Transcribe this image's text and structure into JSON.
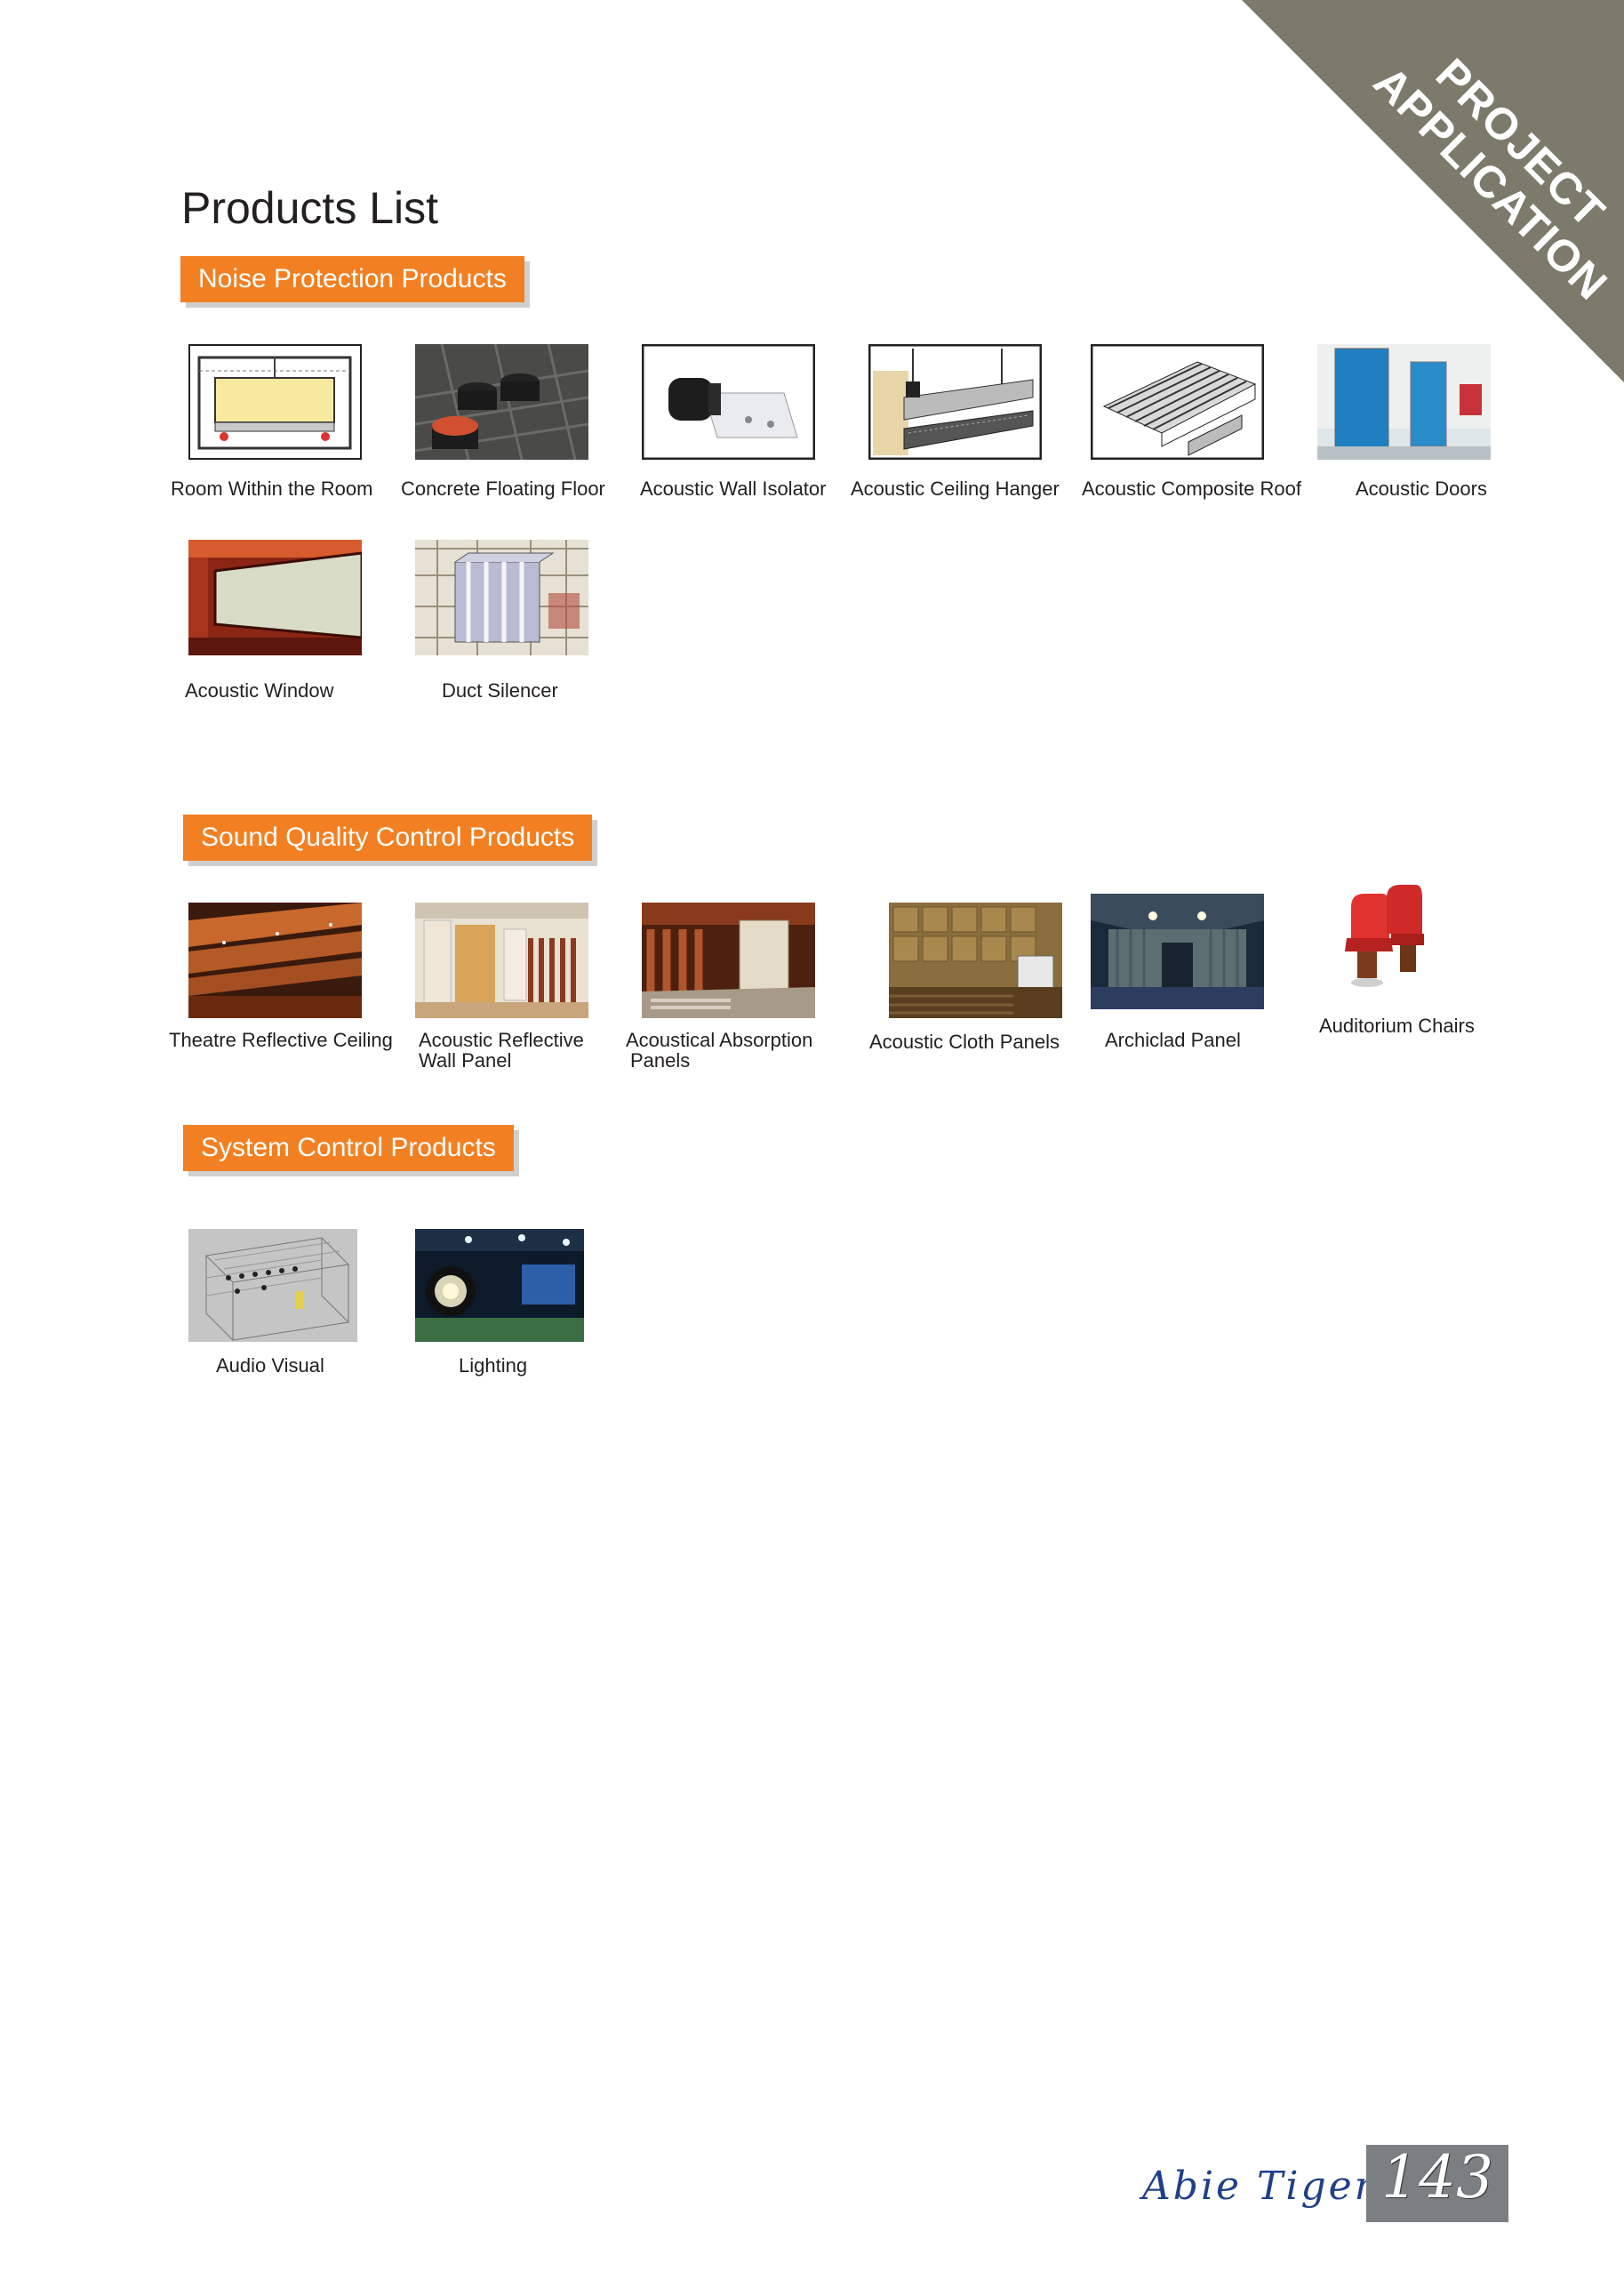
{
  "corner_banner": {
    "line1": "PROJECT",
    "line2": "APPLICATION"
  },
  "page_title": "Products List",
  "sections": {
    "noise": {
      "title": "Noise Protection Products",
      "items": [
        {
          "label": "Room Within the Room",
          "icon": "room-within-room-diagram"
        },
        {
          "label": "Concrete Floating Floor",
          "icon": "floating-floor-photo"
        },
        {
          "label": "Acoustic Wall Isolator",
          "icon": "wall-isolator-photo"
        },
        {
          "label": "Acoustic Ceiling Hanger",
          "icon": "ceiling-hanger-diagram"
        },
        {
          "label": "Acoustic Composite Roof",
          "icon": "composite-roof-diagram"
        },
        {
          "label": "Acoustic Doors",
          "icon": "doors-photo"
        },
        {
          "label": "Acoustic Window",
          "icon": "window-photo"
        },
        {
          "label": "Duct Silencer",
          "icon": "duct-silencer-photo"
        }
      ]
    },
    "sound": {
      "title": "Sound Quality Control Products",
      "items": [
        {
          "label": "Theatre Reflective Ceiling",
          "icon": "reflective-ceiling-photo"
        },
        {
          "label": "Acoustic Reflective",
          "label2": "Wall Panel",
          "icon": "reflective-wall-photo"
        },
        {
          "label": "Acoustical Absorption",
          "label2": "Panels",
          "icon": "absorption-panels-photo"
        },
        {
          "label": "Acoustic Cloth Panels",
          "icon": "cloth-panels-photo"
        },
        {
          "label": "Archiclad Panel",
          "icon": "archiclad-photo"
        },
        {
          "label": "Auditorium Chairs",
          "icon": "auditorium-chairs-photo"
        }
      ]
    },
    "system": {
      "title": "System Control Products",
      "items": [
        {
          "label": "Audio Visual",
          "icon": "audio-visual-diagram"
        },
        {
          "label": "Lighting",
          "icon": "lighting-photo"
        }
      ]
    }
  },
  "footer": {
    "brand": "Abie Tiger",
    "page_number": "143"
  },
  "colors": {
    "accent": "#f28023",
    "banner": "#7d7a6c",
    "page_box": "#7c7f82",
    "brand": "#1f3f8a"
  }
}
